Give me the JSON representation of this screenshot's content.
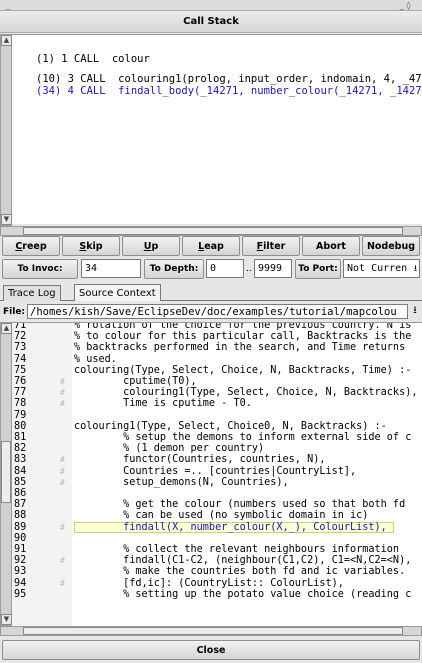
{
  "window": {
    "title": "Call Stack"
  },
  "call_stack": {
    "lines": [
      {
        "text": "(1) 1 CALL  colour",
        "color": "#000000"
      },
      {
        "text": "(10) 3 CALL  colouring1(prolog, input_order, indomain, 4, _47",
        "color": "#000000"
      },
      {
        "text": "(34) 4 CALL  findall_body(_14271, number_colour(_14271, _1427",
        "color": "#1a1aa6"
      }
    ]
  },
  "toolbar": {
    "buttons": [
      {
        "key": "creep",
        "label": "Creep"
      },
      {
        "key": "skip",
        "label": "Skip"
      },
      {
        "key": "up",
        "label": "Up"
      },
      {
        "key": "leap",
        "label": "Leap"
      },
      {
        "key": "filter",
        "label": "Filter"
      },
      {
        "key": "abort",
        "label": "Abort"
      },
      {
        "key": "nodebug",
        "label": "Nodebug"
      }
    ]
  },
  "invoc_row": {
    "to_invoc_label": "To Invoc:",
    "to_invoc_value": "34",
    "to_depth_label": "To Depth:",
    "depth_from": "0",
    "depth_sep": "..",
    "depth_to": "9999",
    "to_port_label": "To Port:",
    "port_value": "Not Curren"
  },
  "tabs": [
    {
      "label": "Trace Log",
      "active": false
    },
    {
      "label": "Source Context",
      "active": true
    }
  ],
  "file": {
    "label": "File:",
    "path": "/homes/kish/Save/EclipseDev/doc/examples/tutorial/mapcolou"
  },
  "source": {
    "highlight_line": "89",
    "highlight_color": "#ffffd8",
    "lines": [
      {
        "n": "71",
        "m": "",
        "code": "% rotation of the choice for the previous country. N is"
      },
      {
        "n": "72",
        "m": "",
        "code": "% to colour for this particular call, Backtracks is the"
      },
      {
        "n": "73",
        "m": "",
        "code": "% backtracks performed in the search, and Time returns"
      },
      {
        "n": "74",
        "m": "",
        "code": "% used."
      },
      {
        "n": "75",
        "m": "",
        "code": "colouring(Type, Select, Choice, N, Backtracks, Time) :-"
      },
      {
        "n": "76",
        "m": "#",
        "code": "        cputime(T0),"
      },
      {
        "n": "77",
        "m": "#",
        "code": "        colouring1(Type, Select, Choice, N, Backtracks),"
      },
      {
        "n": "78",
        "m": "#",
        "code": "        Time is cputime - T0."
      },
      {
        "n": "79",
        "m": "",
        "code": ""
      },
      {
        "n": "80",
        "m": "",
        "code": "colouring1(Type, Select, Choice0, N, Backtracks) :-"
      },
      {
        "n": "81",
        "m": "",
        "code": "        % setup the demons to inform external side of c"
      },
      {
        "n": "82",
        "m": "",
        "code": "        % (1 demon per country)"
      },
      {
        "n": "83",
        "m": "#",
        "code": "        functor(Countries, countries, N),"
      },
      {
        "n": "84",
        "m": "#",
        "code": "        Countries =.. [countries|CountryList],"
      },
      {
        "n": "85",
        "m": "#",
        "code": "        setup_demons(N, Countries),"
      },
      {
        "n": "86",
        "m": "",
        "code": ""
      },
      {
        "n": "87",
        "m": "",
        "code": "        % get the colour (numbers used so that both fd"
      },
      {
        "n": "88",
        "m": "",
        "code": "        % can be used (no symbolic domain in ic)"
      },
      {
        "n": "89",
        "m": "#",
        "code": "        findall(X, number_colour(X,_), ColourList),"
      },
      {
        "n": "90",
        "m": "",
        "code": ""
      },
      {
        "n": "91",
        "m": "",
        "code": "        % collect the relevant neighbours information"
      },
      {
        "n": "92",
        "m": "#",
        "code": "        findall(C1-C2, (neighbour(C1,C2), C1=<N,C2=<N),"
      },
      {
        "n": "93",
        "m": "",
        "code": "        % make the countries both fd and ic variables."
      },
      {
        "n": "94",
        "m": "#",
        "code": "        [fd,ic]: (CountryList:: ColourList),"
      },
      {
        "n": "95",
        "m": "",
        "code": "        % setting up the potato value choice (reading c"
      }
    ]
  },
  "close_button": {
    "label": "Close"
  }
}
